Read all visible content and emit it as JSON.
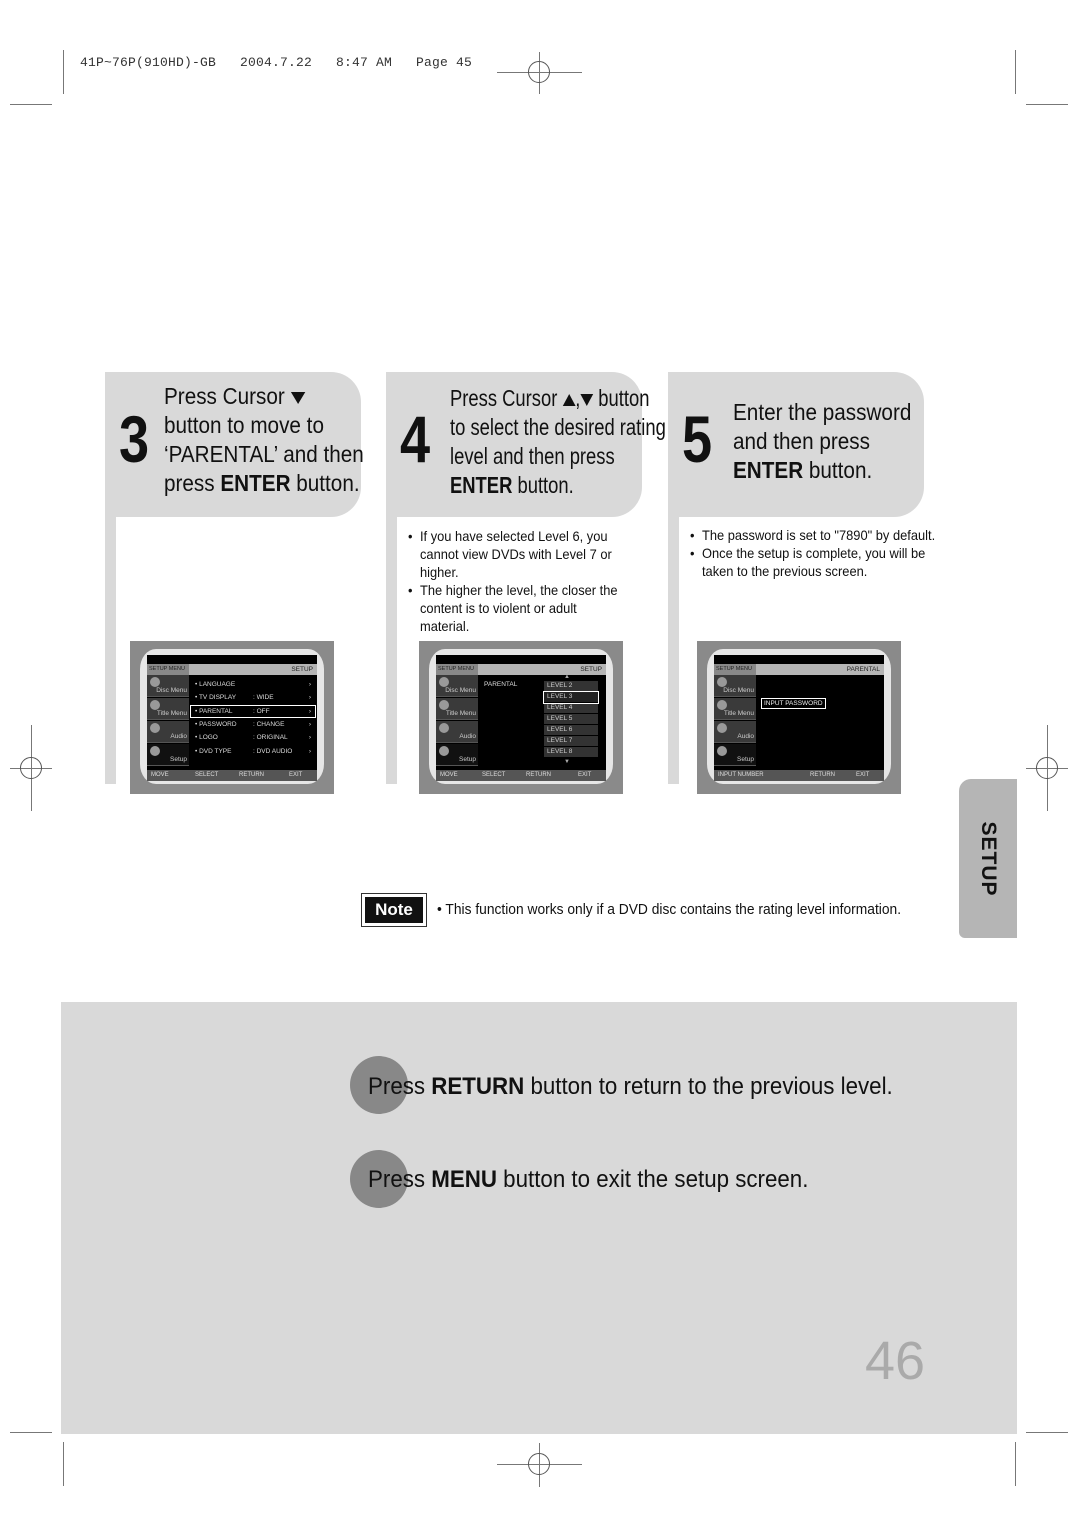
{
  "print_slug": "41P~76P(910HD)-GB   2004.7.22   8:47 AM   Page 45",
  "steps": [
    {
      "number": "3",
      "lines": [
        "Press Cursor",
        "button to move to",
        "‘PARENTAL’ and then",
        "press ",
        "ENTER",
        " button."
      ],
      "cursor_icons": [
        "triangle-down-icon"
      ],
      "bullets": []
    },
    {
      "number": "4",
      "lines": [
        "Press Cursor",
        ",",
        "button",
        "to select the desired rating",
        "level and then press",
        "ENTER",
        " button."
      ],
      "cursor_icons": [
        "triangle-up-icon",
        "triangle-down-icon"
      ],
      "bullets": [
        "If you have selected Level 6, you cannot view DVDs with Level 7 or higher.",
        "The higher the level, the closer the content is to violent or adult material."
      ]
    },
    {
      "number": "5",
      "lines": [
        "Enter the password",
        "and then press",
        "ENTER",
        " button."
      ],
      "bullets": [
        "The password is set to \"7890\" by default.",
        "Once the setup is complete, you will be taken to the previous screen."
      ]
    }
  ],
  "osd": {
    "sidebar": [
      "Disc Menu",
      "Title Menu",
      "Audio",
      "Setup"
    ],
    "screen1": {
      "header_left": "SETUP MENU",
      "header_right": "SETUP",
      "rows": [
        {
          "key": "LANGUAGE",
          "value": "",
          "selected": false
        },
        {
          "key": "TV DISPLAY",
          "value": "WIDE",
          "selected": false
        },
        {
          "key": "PARENTAL",
          "value": "OFF",
          "selected": true
        },
        {
          "key": "PASSWORD",
          "value": "CHANGE",
          "selected": false
        },
        {
          "key": "LOGO",
          "value": "ORIGINAL",
          "selected": false
        },
        {
          "key": "DVD TYPE",
          "value": "DVD AUDIO",
          "selected": false
        }
      ],
      "footer": [
        "MOVE",
        "SELECT",
        "RETURN",
        "EXIT"
      ]
    },
    "screen2": {
      "header_left": "SETUP MENU",
      "header_right": "SETUP",
      "item": "PARENTAL",
      "levels": [
        "LEVEL 2",
        "LEVEL 3",
        "LEVEL 4",
        "LEVEL 5",
        "LEVEL 6",
        "LEVEL 7",
        "LEVEL 8"
      ],
      "selected_level": "LEVEL 3",
      "footer": [
        "MOVE",
        "SELECT",
        "RETURN",
        "EXIT"
      ]
    },
    "screen3": {
      "header_left": "SETUP MENU",
      "header_right": "PARENTAL",
      "prompt": "INPUT PASSWORD",
      "footer": [
        "INPUT NUMBER",
        "RETURN",
        "EXIT"
      ]
    }
  },
  "note": {
    "label": "Note",
    "text": "This function works only if a DVD disc contains the rating level information."
  },
  "side_tab": "SETUP",
  "instructions": [
    {
      "pre": "Press ",
      "bold": "RETURN",
      "post": " button to return to the previous level."
    },
    {
      "pre": "Press ",
      "bold": "MENU",
      "post": " button to exit the setup screen."
    }
  ],
  "page_number": "46",
  "colors": {
    "panel_gray": "#d9d9d9",
    "tab_gray": "#b5b5b5",
    "dot_gray": "#888888",
    "page_num_gray": "#aaaaaa"
  }
}
